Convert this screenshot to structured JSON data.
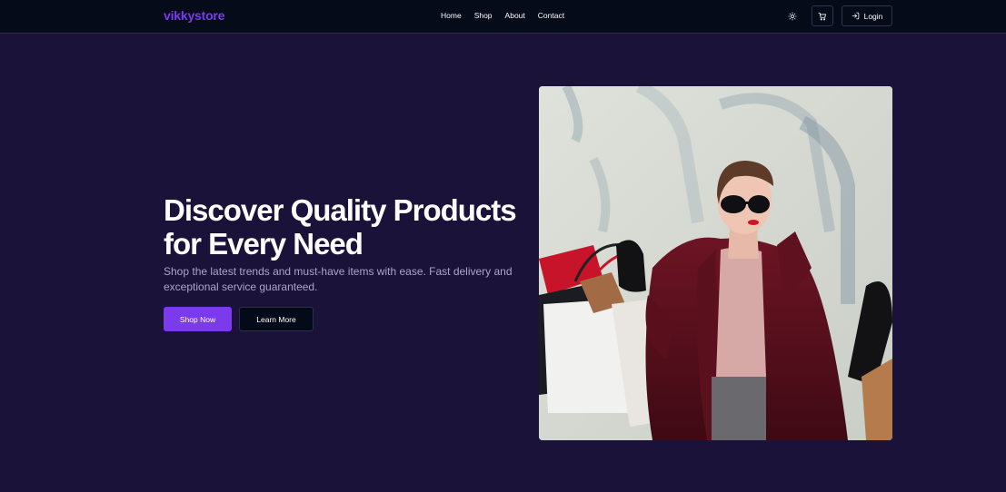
{
  "header": {
    "brand": "vikkystore",
    "nav": [
      "Home",
      "Shop",
      "About",
      "Contact"
    ],
    "login_label": "Login",
    "icons": {
      "theme": "sun-icon",
      "cart": "cart-icon",
      "login": "login-icon"
    }
  },
  "hero": {
    "title_line1": "Discover Quality Products",
    "title_line2": "for Every Need",
    "subtitle": "Shop the latest trends and must-have items with ease. Fast delivery and exceptional service guaranteed.",
    "primary_label": "Shop Now",
    "secondary_label": "Learn More",
    "image_subject": "woman in sunglasses holding shopping bags"
  },
  "colors": {
    "background": "#1a1238",
    "navbar": "#060b1a",
    "accent": "#7c3aed",
    "muted_text": "#a9a7c6"
  }
}
